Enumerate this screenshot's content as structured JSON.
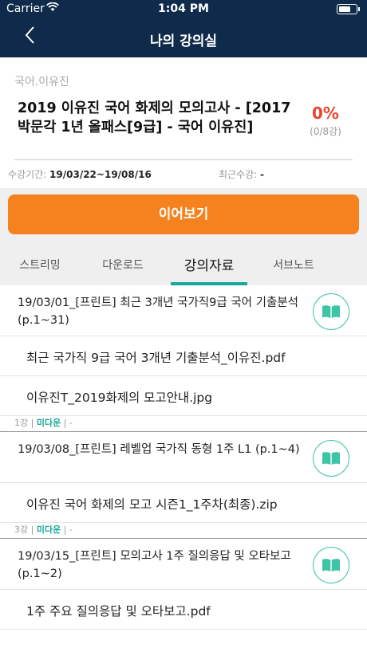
{
  "status_bar": {
    "carrier": "Carrier",
    "time": "1:04 PM"
  },
  "nav": {
    "title": "나의 강의실"
  },
  "course": {
    "teacher": "국어.이유진",
    "title": "2019 이유진 국어 화제의 모의고사 - [2017 박문각 1년 올패스[9급] - 국어 이유진]",
    "progress_percent": "0%",
    "progress_count": "(0/8강)",
    "period_label": "수강기간:",
    "period_value": "19/03/22~19/08/16",
    "recent_label": "최근수강:",
    "recent_value": "-"
  },
  "resume_button": "이어보기",
  "tabs": [
    {
      "label": "스트리밍",
      "active": false
    },
    {
      "label": "다운로드",
      "active": false
    },
    {
      "label": "강의자료",
      "active": true
    },
    {
      "label": "서브노트",
      "active": false
    }
  ],
  "materials": [
    {
      "title": "19/03/01_[프린트] 최근 3개년 국가직9급 국어 기출분석(p.1~31)",
      "files": [
        "최근 국가직 9급 국어 3개년 기출분석_이유진.pdf",
        "이유진T_2019화제의 모고안내.jpg"
      ],
      "footer": {
        "lecture": "1강",
        "status": "미다운",
        "extra": "-"
      }
    },
    {
      "title": "19/03/08_[프린트] 레벨업 국가직 동형 1주 L1 (p.1~4)",
      "files": [
        "이유진 국어 화제의 모고 시즌1_1주차(최종).zip"
      ],
      "footer": {
        "lecture": "3강",
        "status": "미다운",
        "extra": "-"
      }
    },
    {
      "title": "19/03/15_[프린트] 모의고사 1주 질의응답 및 오타보고(p.1~2)",
      "files": [
        "1주 주요 질의응답 및 오타보고.pdf"
      ]
    }
  ],
  "colors": {
    "nav_bg": "#0f2a4a",
    "accent_orange": "#f5821f",
    "accent_teal": "#1aa89a",
    "progress_red": "#e8452c"
  },
  "icons": [
    "back-chevron-icon",
    "wifi-icon",
    "battery-icon",
    "book-icon"
  ]
}
